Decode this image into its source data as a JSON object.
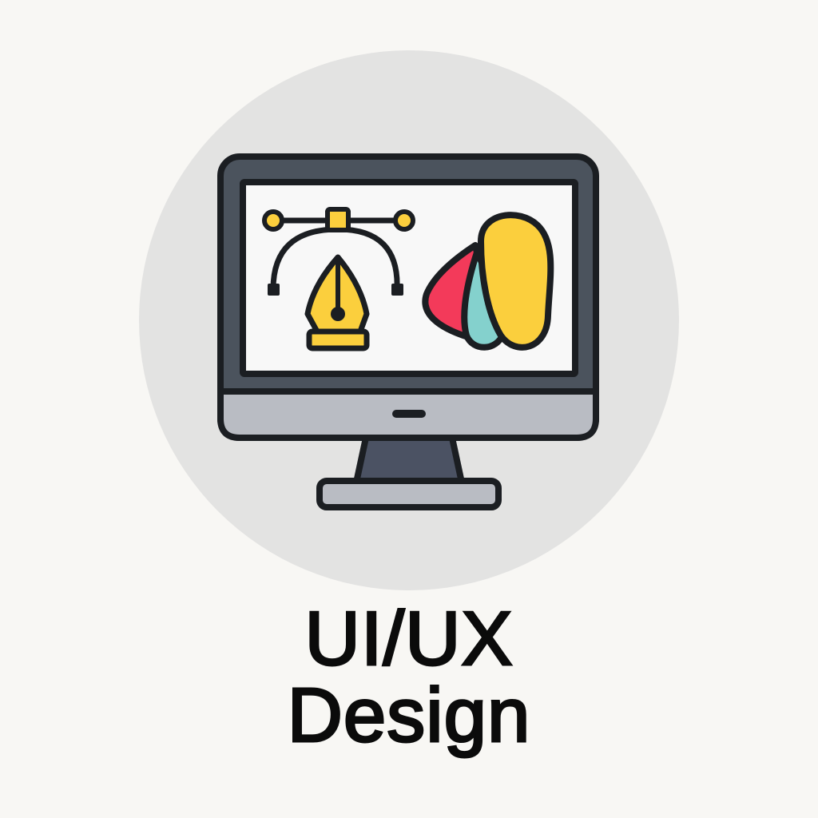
{
  "icon": {
    "name": "ui-ux-design-monitor-icon",
    "elements": [
      "bezier-pen-icon",
      "color-swatch-fan-icon"
    ]
  },
  "caption": {
    "line1": "UI/UX",
    "line2": "Design"
  },
  "colors": {
    "page_background": "#f8f7f4",
    "circle_background": "#e3e3e2",
    "outline": "#1b1e22",
    "monitor_frame": "#4b535d",
    "monitor_screen": "#f8f8f8",
    "monitor_chin": "#b9bcc3",
    "monitor_stand": "#4b5263",
    "monitor_base": "#b9bcc3",
    "pen_yellow": "#fbcf3d",
    "swatch_red": "#f33a5a",
    "swatch_teal": "#84d1cd",
    "swatch_yellow": "#fbcf3d",
    "caption_text": "#0b0b0b"
  }
}
